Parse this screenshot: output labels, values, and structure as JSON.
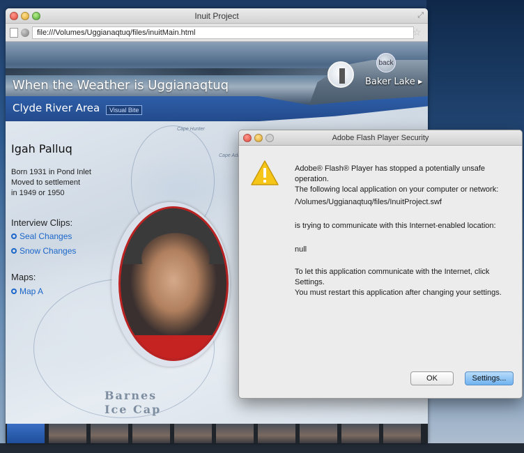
{
  "window": {
    "title": "Inuit Project",
    "url": "file:///Volumes/Uggianaqtuq/files/inuitMain.html"
  },
  "banner": {
    "title": "When the Weather is Uggianaqtuq",
    "area": "Clyde River Area",
    "visual_bite": "Visual Bite",
    "back_label": "back",
    "destination": "Baker Lake"
  },
  "map": {
    "cape_label": "Cape Hunter",
    "cape_label2": "Cape Adair",
    "barnes_line1": "Barnes",
    "barnes_line2": "Ice Cap"
  },
  "profile": {
    "name": "Igah Palluq",
    "bio_line1": "Born 1931 in Pond Inlet",
    "bio_line2": "Moved to settlement",
    "bio_line3": "in 1949 or 1950",
    "clips_heading": "Interview Clips:",
    "clips": [
      "Seal Changes",
      "Snow Changes"
    ],
    "maps_heading": "Maps:",
    "maps": [
      "Map A"
    ]
  },
  "dialog": {
    "title": "Adobe Flash Player Security",
    "line1": "Adobe® Flash® Player has stopped a potentially unsafe operation.",
    "line2": "The following local application on your computer or network:",
    "path": "/Volumes/Uggianaqtuq/files/InuitProject.swf",
    "line3": "is trying to communicate with this Internet-enabled location:",
    "location": "null",
    "line4": "To let this application communicate with the Internet, click Settings.",
    "line5": "You must restart this application after changing your settings.",
    "ok_label": "OK",
    "settings_label": "Settings..."
  },
  "colors": {
    "accent": "#2e5ea8",
    "link": "#1a66c9",
    "warning": "#f5c518"
  }
}
